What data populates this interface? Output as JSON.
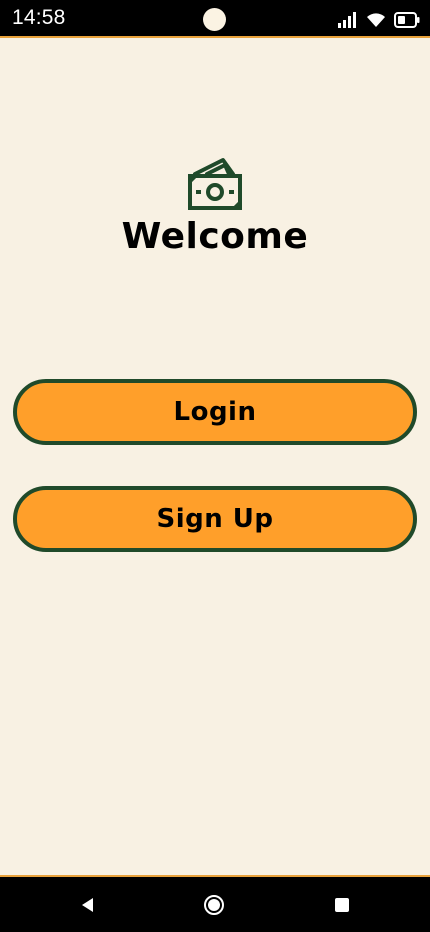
{
  "status_bar": {
    "time": "14:58",
    "icons": [
      "signal-icon",
      "wifi-icon",
      "battery-icon"
    ]
  },
  "welcome": {
    "icon": "money-bills-icon",
    "title": "Welcome"
  },
  "actions": {
    "login_label": "Login",
    "signup_label": "Sign Up"
  },
  "navigation": {
    "buttons": [
      "back-icon",
      "home-icon",
      "recents-icon"
    ]
  },
  "colors": {
    "background": "#F8F1E3",
    "button_fill": "#FF9F2A",
    "button_border": "#204A2A",
    "icon_green": "#1F4A2A",
    "accent_line": "#E9A23B",
    "bars": "#000000"
  }
}
